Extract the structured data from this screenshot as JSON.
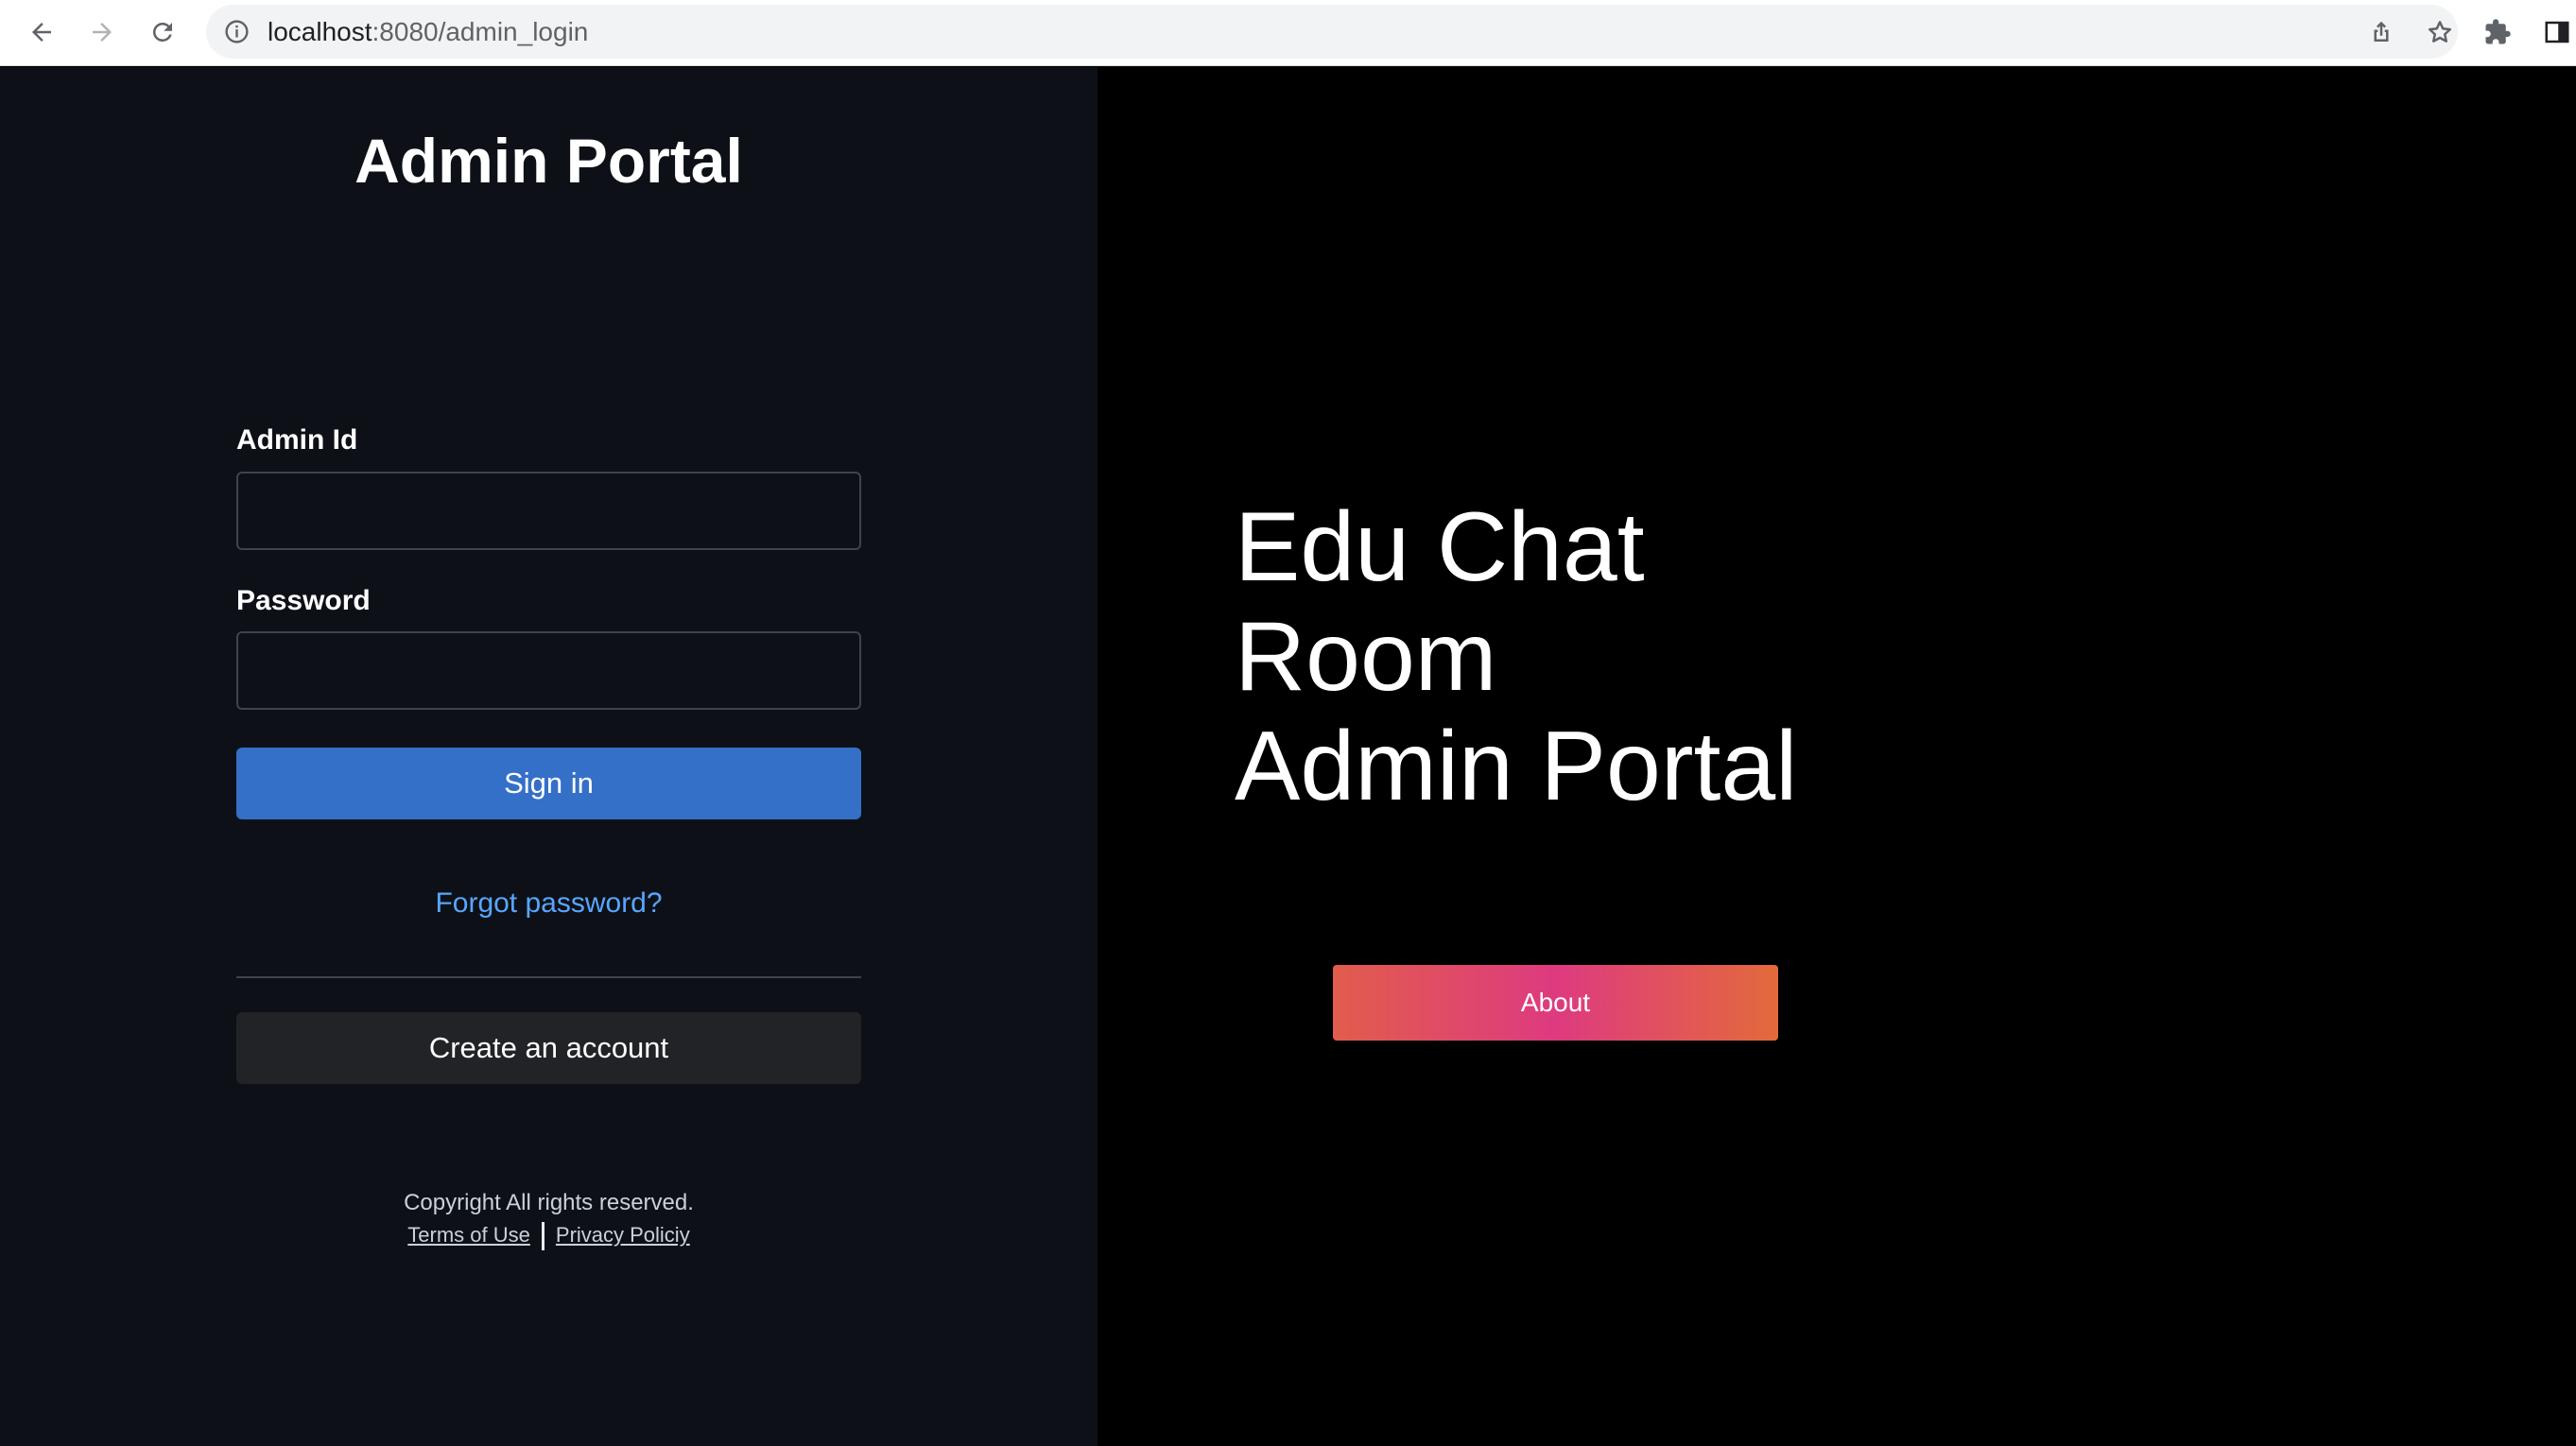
{
  "browser": {
    "url_host": "localhost",
    "url_rest": ":8080/admin_login",
    "icons": [
      "back-arrow-icon",
      "forward-arrow-icon",
      "reload-icon",
      "info-icon",
      "share-icon",
      "star-icon",
      "extensions-icon",
      "sidepanel-icon"
    ]
  },
  "login": {
    "title": "Admin Portal",
    "admin_id_label": "Admin Id",
    "admin_id_value": "",
    "password_label": "Password",
    "password_value": "",
    "signin_label": "Sign in",
    "forgot_label": "Forgot password?",
    "create_label": "Create an account"
  },
  "footer": {
    "copyright": "Copyright All rights reserved.",
    "terms": "Terms of Use",
    "privacy": "Privacy Policiy"
  },
  "hero": {
    "line1": "Edu Chat",
    "line2": "Room",
    "line3": "Admin Portal",
    "about_label": "About"
  },
  "colors": {
    "left_bg": "#0d1117",
    "right_bg": "#000000",
    "primary": "#3470c7",
    "link": "#58a6ff",
    "about_gradient_start": "#e15d4c",
    "about_gradient_mid": "#de3a80",
    "about_gradient_end": "#e36a3b"
  }
}
